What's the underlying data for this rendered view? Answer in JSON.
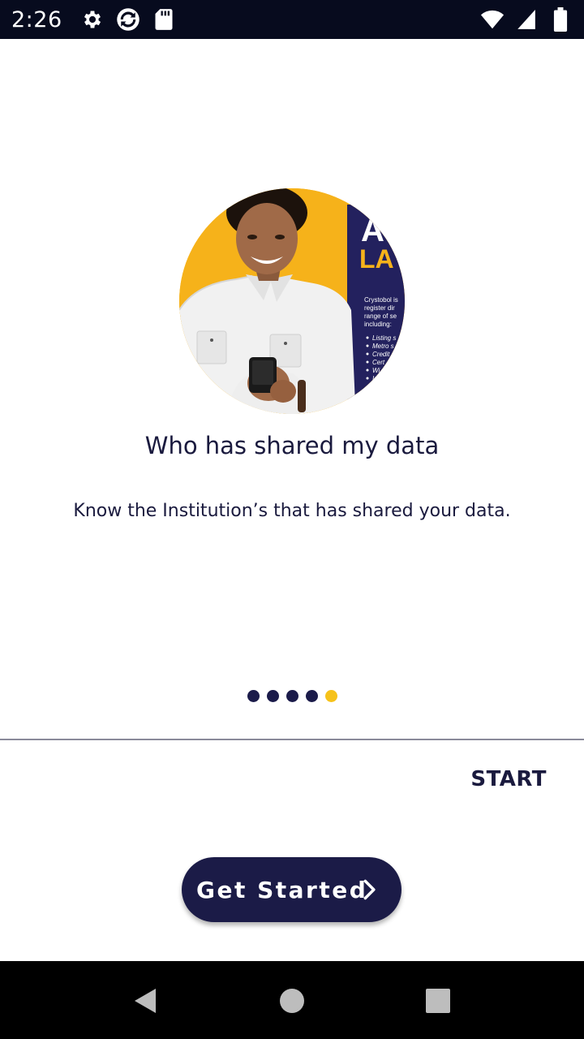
{
  "status_bar": {
    "time": "2:26",
    "icons": [
      "settings-icon",
      "sync-icon",
      "sd-card-icon",
      "wifi-icon",
      "signal-icon",
      "battery-icon"
    ]
  },
  "onboarding": {
    "title": "Who has shared my data",
    "subtitle": "Know the Institution’s that has shared your data.",
    "page_count": 5,
    "active_page": 5,
    "start_label": "START",
    "get_started_label": "Get Started"
  },
  "hero_image": {
    "description_icon": "person-with-phone-photo",
    "poster_text": [
      "A",
      "LA",
      "Crystobol is",
      "register dir",
      "range of se",
      "including:",
      "Listing s",
      "Metro s",
      "Credit",
      "Cert",
      "Wi",
      "In"
    ]
  },
  "colors": {
    "primary": "#1b1b47",
    "accent": "#f6c21a",
    "status_bar": "#070b1e"
  },
  "nav_bar": {
    "buttons": [
      "back-icon",
      "home-icon",
      "recents-icon"
    ]
  }
}
